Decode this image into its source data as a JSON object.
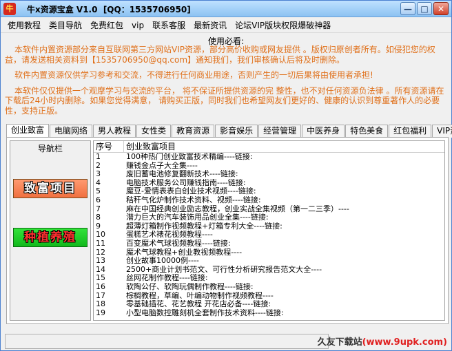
{
  "window": {
    "title": "牛x资源宝盒 V1.0  [QQ：1535706950]",
    "icon_label": "牛",
    "controls": [
      "—",
      "□",
      "✕"
    ]
  },
  "menu": [
    "使用教程",
    "类目导航",
    "免费红包",
    "vip",
    "联系客服",
    "最新资讯",
    "论坛VIP版块权限爆破神器"
  ],
  "notice": {
    "title": "使用必看:",
    "paragraphs": [
      "本软件内置资源部分来自互联网第三方网站VIP资源，部分高价收购或网友提供 。版权归原创者所有。如侵犯您的权益，请发送相关资料到【1535706950@qq.com】通知我们，我们审核确认后将及时删除。",
      "软件内置资源仅供学习参考和交流，不得进行任何商业用途，否则产生的一切后果将由使用者承担!",
      "本软件仅仅提供一个观摩学习与交流的平台， 将不保证所提供资源的完 整性，也不对任何资源负法律 。所有资源请在下载后24小时内删除。如果您觉得满意， 请购买正版，同时我们也希望网友们更好的、健康的认识到尊重著作人的必要性，支持正版。"
    ]
  },
  "tabs": [
    "创业致富",
    "电脑网络",
    "男人教程",
    "女性类",
    "教育资源",
    "影音娱乐",
    "经营管理",
    "中医养身",
    "特色美食",
    "红包福利",
    "VIP资源"
  ],
  "nav": {
    "title": "导航栏",
    "btn_rich": "致富项目",
    "btn_plant": "种植养殖"
  },
  "list": {
    "col_num": "序号",
    "col_title": "创业致富项目",
    "rows": [
      [
        "1",
        "100种热门创业致富技术精编----链接:"
      ],
      [
        "2",
        "赚钱金点子大全集----"
      ],
      [
        "3",
        "废旧蓄电池修复翻新技术----链接:"
      ],
      [
        "4",
        "电脑技术服务公司赚钱指南----链接:"
      ],
      [
        "5",
        "魔豆-爱情表表白创业技术视频----链接:"
      ],
      [
        "6",
        "秸秆气化炉制作技术资料、视频----链接:"
      ],
      [
        "7",
        "麻在中国经典创业励志教程，创业实战全集视频（第一二三季）----"
      ],
      [
        "8",
        "潜力巨大的汽车装饰用品创业全集----链接:"
      ],
      [
        "9",
        "超薄灯箱制作视频教程+灯箱专利大全----链接:"
      ],
      [
        "10",
        "蛋糕艺术裱花视频教程----"
      ],
      [
        "11",
        "百变魔术气球视频教程----链接:"
      ],
      [
        "12",
        "魔术气球教程+创业教视频教程----"
      ],
      [
        "13",
        "创业故事10000例----"
      ],
      [
        "14",
        "2500+商业计划书范文、可行性分析研究报告范文大全----"
      ],
      [
        "15",
        "丝网花制作教程----链接:"
      ],
      [
        "16",
        "软陶公仔、软陶玩偶制作教程----链接:"
      ],
      [
        "17",
        "棕榈教程，草编、叶编动物制作视频教程----"
      ],
      [
        "18",
        "零基础插花、花艺教程 开花店必备----链接:"
      ],
      [
        "19",
        "小型电脑数控雕刻机全套制作技术资料----链接:"
      ]
    ]
  },
  "status": {
    "brand_prefix": "久友下载站",
    "brand_domain": "(www.9upk.com)"
  }
}
